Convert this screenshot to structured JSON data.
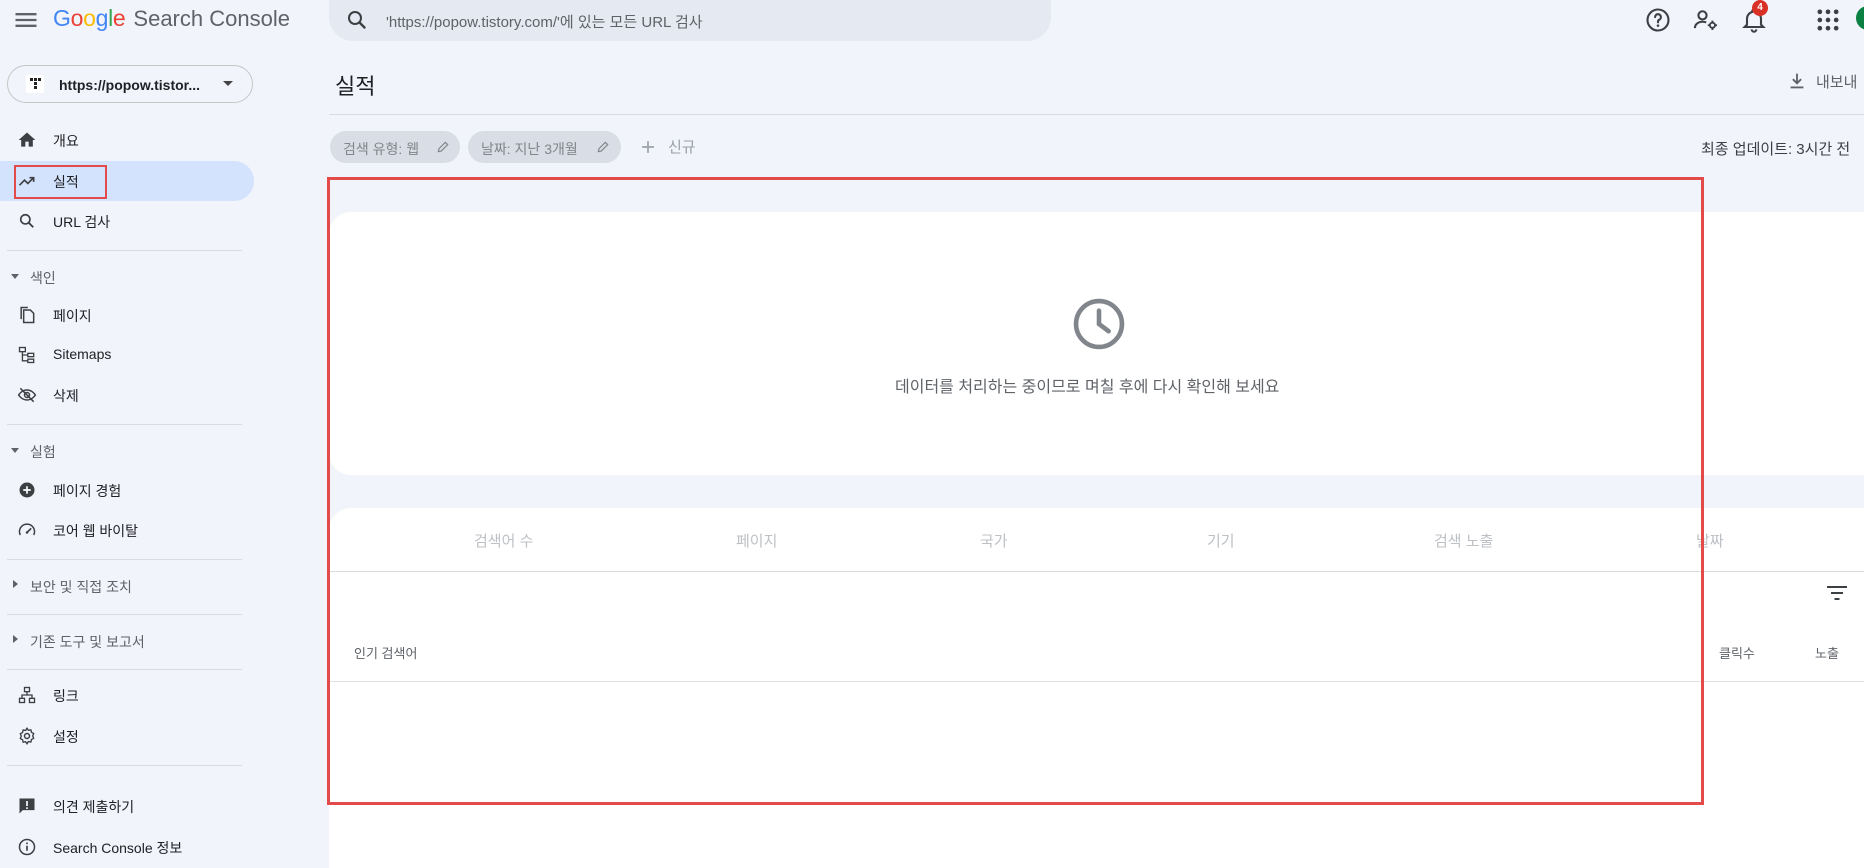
{
  "topbar": {
    "app_name": "Search Console",
    "logo_letters": [
      "G",
      "o",
      "o",
      "g",
      "l",
      "e"
    ],
    "search_placeholder": "'https://popow.tistory.com/'에 있는 모든 URL 검사",
    "notification_count": "4",
    "icons": [
      "menu-icon",
      "search-icon",
      "help-icon",
      "manage-users-icon",
      "bell-icon",
      "apps-grid-icon"
    ]
  },
  "property": {
    "name": "https://popow.tistor..."
  },
  "sidebar": {
    "overview": "개요",
    "performance": "실적",
    "url_inspection": "URL 검사",
    "index_section": "색인",
    "pages": "페이지",
    "sitemaps": "Sitemaps",
    "removals": "삭제",
    "experience_section": "실험",
    "page_experience": "페이지 경험",
    "core_web_vitals": "코어 웹 바이탈",
    "security_section": "보안 및 직접 조치",
    "legacy_section": "기존 도구 및 보고서",
    "links": "링크",
    "settings": "설정",
    "feedback": "의견 제출하기",
    "about": "Search Console 정보"
  },
  "main": {
    "title": "실적",
    "export_label": "내보내",
    "filters": {
      "search_type": "검색 유형: 웹",
      "date": "날짜: 지난 3개월",
      "new_label": "신규"
    },
    "last_updated": "최종 업데이트: 3시간 전",
    "processing_message": "데이터를 처리하는 중이므로 며칠 후에 다시 확인해 보세요",
    "tabs": [
      "검색어 수",
      "페이지",
      "국가",
      "기기",
      "검색 노출",
      "날짜"
    ],
    "table": {
      "col_query": "인기 검색어",
      "col_clicks": "클릭수",
      "col_impressions": "노출"
    }
  },
  "colors": {
    "accent": "#1a73e8",
    "active_nav": "#d3e3fd",
    "highlight": "#e34b4b",
    "background": "#f1f4fa"
  }
}
